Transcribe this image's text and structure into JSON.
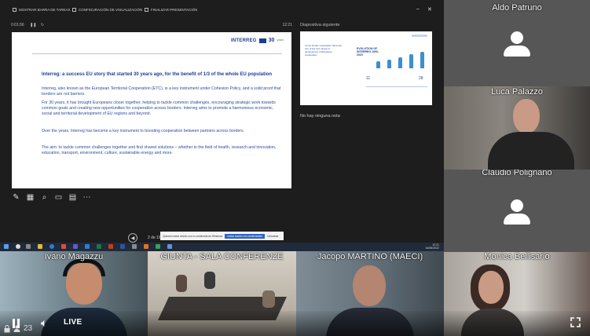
{
  "ppt": {
    "toolbar": [
      "MOSTRAR BARRA DE TAREAS",
      "CONFIGURACIÓN DE VISUALIZACIÓN",
      "FINALIZAR PRESENTACIÓN"
    ],
    "timer": "0:01:56",
    "clock_small": "12:21",
    "next_label": "Diapositiva siguiente",
    "notes": "No hay ninguna nota",
    "page": "2 de 16"
  },
  "slide": {
    "logo_brand": "INTERREG",
    "logo_num": "30",
    "logo_sub": "years",
    "title": "Interreg: a success EU story that started 30 years ago, for the benefit of 1/3 of the whole EU population",
    "paragraphs": [
      "Interreg, also known as the European Territorial Cooperation (ETC), is a key instrument under Cohesion Policy, and a solid proof that borders are not barriers.",
      "For 30 years, it has brought Europeans closer together, helping to tackle common challenges, encouraging strategic work towards common goals and creating new opportunities for cooperation across borders. Interreg aims to promote a harmonious economic, social and territorial development of EU regions and beyond.",
      "Over the years, Interreg has become a key instrument to boosting cooperation between partners across borders.",
      "The aim: to tackle common challenges together and find shared solutions – whether in the field of health, research and innovation, education, transport, environment, culture, sustainable energy and more."
    ]
  },
  "next_slide": {
    "title": "EVOLUTION OF INTERREG 1990-2020",
    "left_text": "Cross-border cooperation has been one of the core areas of development of European cooperation",
    "numbers": [
      "11",
      "",
      "",
      "",
      "28"
    ]
  },
  "notification": {
    "text": "Quieres iniciar sesión con tu credencial de Windows",
    "primary": "Iniciar sesión con credenciales",
    "secondary": "Descartar"
  },
  "taskbar": {
    "time": "12:21",
    "date": "16/06/2022"
  },
  "participants": [
    {
      "id": "aldo",
      "name": "Aldo Patruno"
    },
    {
      "id": "luca",
      "name": "Luca Palazzo"
    },
    {
      "id": "claudio",
      "name": "Claudio Polignano"
    },
    {
      "id": "ivano",
      "name": "Ivano Magazzu"
    },
    {
      "id": "giunta",
      "name": "GIUNTA - SALA CONFERENZE"
    },
    {
      "id": "jacopo",
      "name": "Jacopo MARTINO (MAECI)"
    },
    {
      "id": "monica",
      "name": "Monica Bellisario"
    }
  ],
  "controls": {
    "live": "LIVE",
    "viewers": "23"
  }
}
